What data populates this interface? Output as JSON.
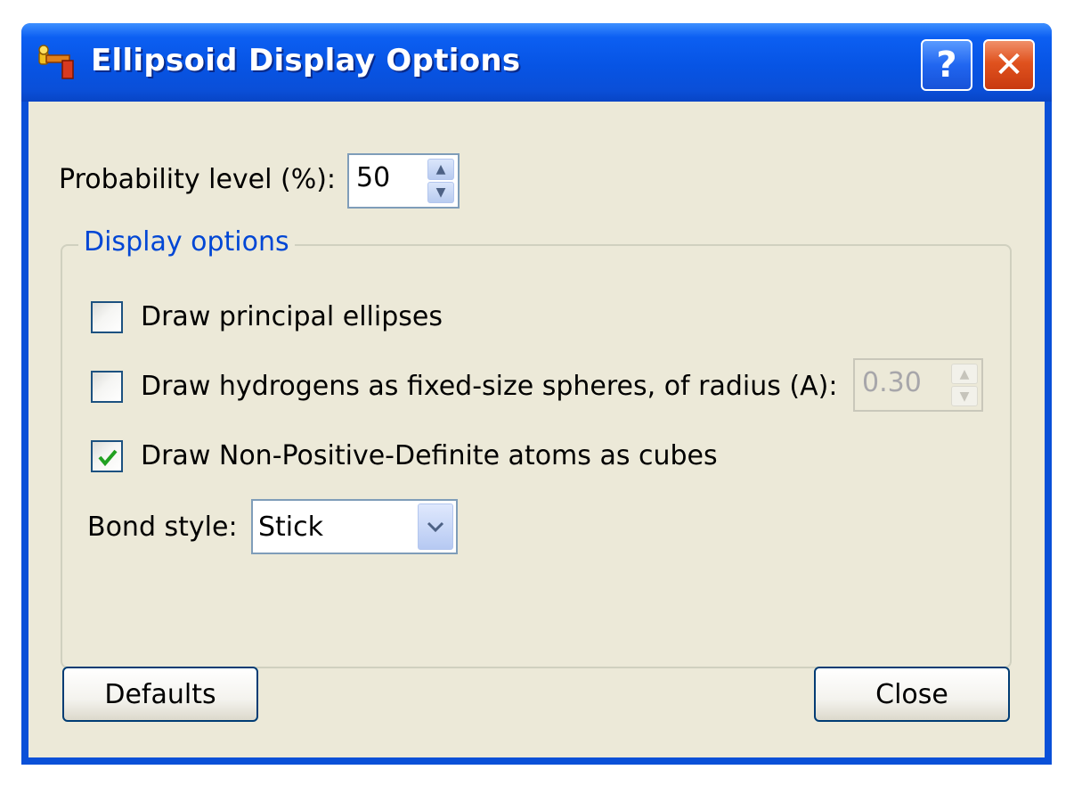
{
  "window": {
    "title": "Ellipsoid Display Options",
    "help_label": "?",
    "close_label": "✕"
  },
  "probability": {
    "label": "Probability level (%):",
    "value": "50"
  },
  "display_options": {
    "title": "Display options",
    "principal_ellipses": {
      "label": "Draw principal ellipses",
      "checked": false
    },
    "hydrogens": {
      "label": "Draw hydrogens as fixed-size spheres, of radius (A):",
      "checked": false,
      "radius_value": "0.30",
      "radius_enabled": false
    },
    "npd_cubes": {
      "label": "Draw Non-Positive-Definite atoms as cubes",
      "checked": true
    },
    "bond_style": {
      "label": "Bond style:",
      "value": "Stick"
    }
  },
  "buttons": {
    "defaults": "Defaults",
    "close": "Close"
  },
  "colors": {
    "titlebar": "#0a50d8",
    "dialog_bg": "#ece9d8",
    "group_title": "#0046d5",
    "check_mark": "#21a121"
  }
}
